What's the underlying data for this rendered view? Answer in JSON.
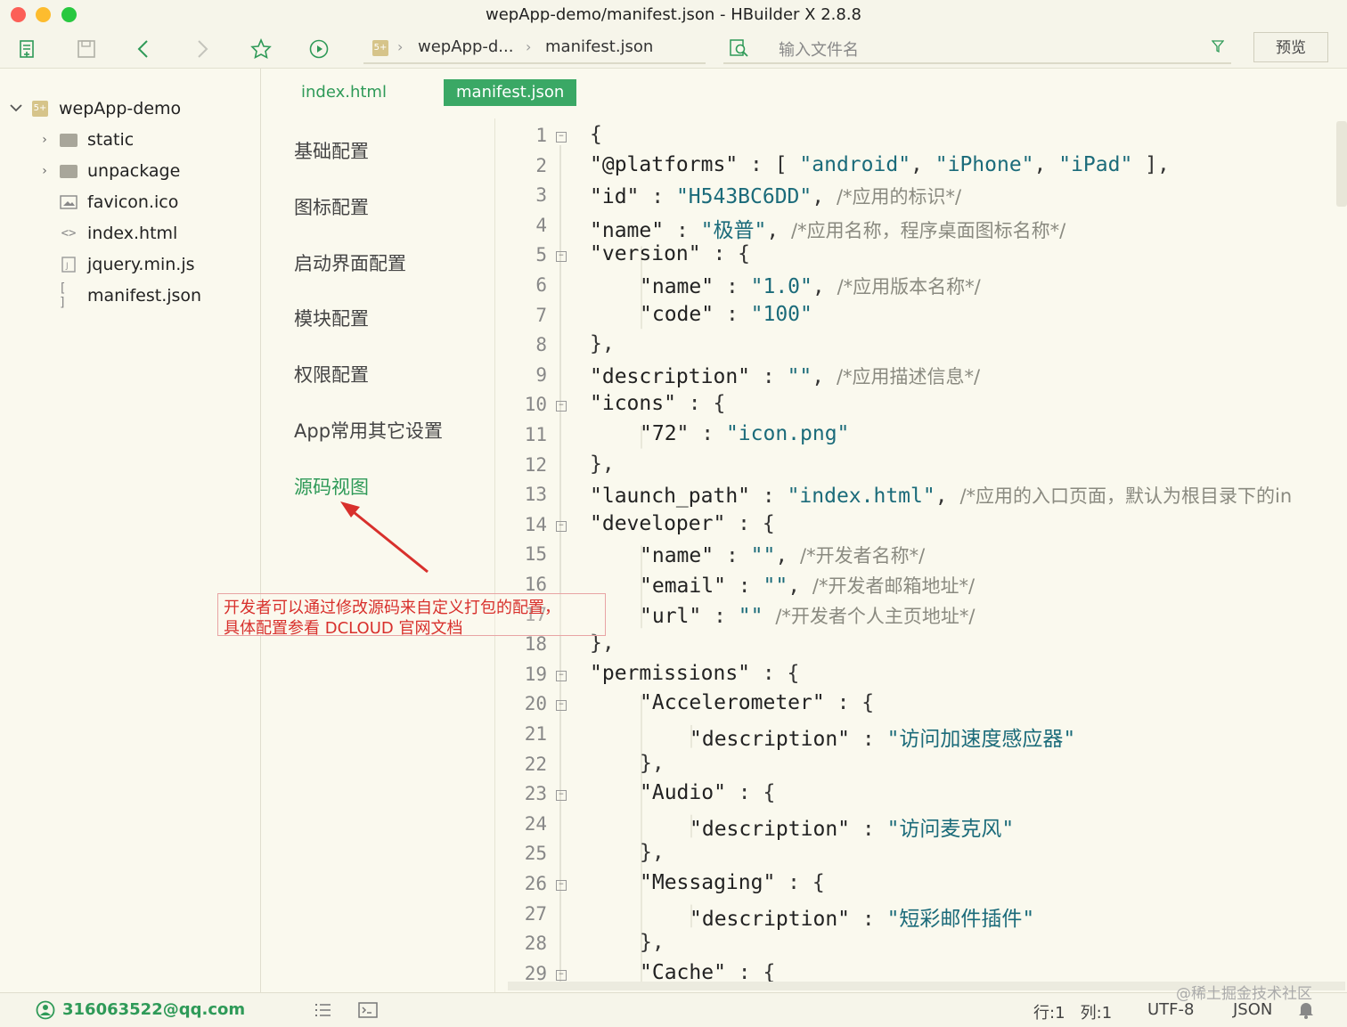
{
  "window": {
    "title": "wepApp-demo/manifest.json - HBuilder X 2.8.8"
  },
  "toolbar": {
    "breadcrumb_project_icon": "5+",
    "breadcrumb_project": "wepApp-d...",
    "breadcrumb_file": "manifest.json",
    "search_placeholder": "输入文件名",
    "preview_label": "预览"
  },
  "sidebar": {
    "project": {
      "name": "wepApp-demo",
      "icon": "5+"
    },
    "items": [
      {
        "label": "static",
        "type": "folder"
      },
      {
        "label": "unpackage",
        "type": "folder"
      },
      {
        "label": "favicon.ico",
        "type": "image"
      },
      {
        "label": "index.html",
        "type": "html"
      },
      {
        "label": "jquery.min.js",
        "type": "js"
      },
      {
        "label": "manifest.json",
        "type": "json"
      }
    ]
  },
  "tabs": [
    {
      "label": "index.html",
      "active": false
    },
    {
      "label": "manifest.json",
      "active": true
    }
  ],
  "settings_menu": [
    {
      "label": "基础配置"
    },
    {
      "label": "图标配置"
    },
    {
      "label": "启动界面配置"
    },
    {
      "label": "模块配置"
    },
    {
      "label": "权限配置"
    },
    {
      "label": "App常用其它设置"
    },
    {
      "label": "源码视图",
      "active": true
    }
  ],
  "annotation": {
    "line1": "开发者可以通过修改源码来自定义打包的配置，",
    "line2": "具体配置参看 DCLOUD 官网文档"
  },
  "editor": {
    "lines": [
      {
        "n": "1",
        "fold": "open",
        "indent": 0,
        "tokens": [
          [
            "p",
            "{"
          ]
        ]
      },
      {
        "n": "2",
        "indent": 0,
        "tokens": [
          [
            "k",
            "\"@platforms\""
          ],
          [
            "p",
            " : [ "
          ],
          [
            "s",
            "\"android\""
          ],
          [
            "p",
            ", "
          ],
          [
            "s",
            "\"iPhone\""
          ],
          [
            "p",
            ", "
          ],
          [
            "s",
            "\"iPad\""
          ],
          [
            "p",
            " ],"
          ]
        ]
      },
      {
        "n": "3",
        "indent": 0,
        "tokens": [
          [
            "k",
            "\"id\""
          ],
          [
            "p",
            " : "
          ],
          [
            "s",
            "\"H543BC6DD\""
          ],
          [
            "p",
            ", "
          ],
          [
            "c",
            "/*应用的标识*/"
          ]
        ]
      },
      {
        "n": "4",
        "indent": 0,
        "tokens": [
          [
            "k",
            "\"name\""
          ],
          [
            "p",
            " : "
          ],
          [
            "s",
            "\"极普\""
          ],
          [
            "p",
            ", "
          ],
          [
            "c",
            "/*应用名称，程序桌面图标名称*/"
          ]
        ]
      },
      {
        "n": "5",
        "fold": "open",
        "indent": 0,
        "tokens": [
          [
            "k",
            "\"version\""
          ],
          [
            "p",
            " : {"
          ]
        ]
      },
      {
        "n": "6",
        "indent": 1,
        "tokens": [
          [
            "k",
            "\"name\""
          ],
          [
            "p",
            " : "
          ],
          [
            "s",
            "\"1.0\""
          ],
          [
            "p",
            ", "
          ],
          [
            "c",
            "/*应用版本名称*/"
          ]
        ]
      },
      {
        "n": "7",
        "indent": 1,
        "tokens": [
          [
            "k",
            "\"code\""
          ],
          [
            "p",
            " : "
          ],
          [
            "s",
            "\"100\""
          ]
        ]
      },
      {
        "n": "8",
        "indent": 0,
        "tokens": [
          [
            "p",
            "},"
          ]
        ]
      },
      {
        "n": "9",
        "indent": 0,
        "tokens": [
          [
            "k",
            "\"description\""
          ],
          [
            "p",
            " : "
          ],
          [
            "s",
            "\"\""
          ],
          [
            "p",
            ", "
          ],
          [
            "c",
            "/*应用描述信息*/"
          ]
        ]
      },
      {
        "n": "10",
        "fold": "open",
        "indent": 0,
        "tokens": [
          [
            "k",
            "\"icons\""
          ],
          [
            "p",
            " : {"
          ]
        ]
      },
      {
        "n": "11",
        "indent": 1,
        "tokens": [
          [
            "k",
            "\"72\""
          ],
          [
            "p",
            " : "
          ],
          [
            "s",
            "\"icon.png\""
          ]
        ]
      },
      {
        "n": "12",
        "indent": 0,
        "tokens": [
          [
            "p",
            "},"
          ]
        ]
      },
      {
        "n": "13",
        "indent": 0,
        "tokens": [
          [
            "k",
            "\"launch_path\""
          ],
          [
            "p",
            " : "
          ],
          [
            "s",
            "\"index.html\""
          ],
          [
            "p",
            ", "
          ],
          [
            "c",
            "/*应用的入口页面，默认为根目录下的in"
          ]
        ]
      },
      {
        "n": "14",
        "fold": "open",
        "indent": 0,
        "tokens": [
          [
            "k",
            "\"developer\""
          ],
          [
            "p",
            " : {"
          ]
        ]
      },
      {
        "n": "15",
        "indent": 1,
        "tokens": [
          [
            "k",
            "\"name\""
          ],
          [
            "p",
            " : "
          ],
          [
            "s",
            "\"\""
          ],
          [
            "p",
            ", "
          ],
          [
            "c",
            "/*开发者名称*/"
          ]
        ]
      },
      {
        "n": "16",
        "indent": 1,
        "tokens": [
          [
            "k",
            "\"email\""
          ],
          [
            "p",
            " : "
          ],
          [
            "s",
            "\"\""
          ],
          [
            "p",
            ", "
          ],
          [
            "c",
            "/*开发者邮箱地址*/"
          ]
        ]
      },
      {
        "n": "17",
        "indent": 1,
        "tokens": [
          [
            "k",
            "\"url\""
          ],
          [
            "p",
            " : "
          ],
          [
            "s",
            "\"\""
          ],
          [
            "p",
            " "
          ],
          [
            "c",
            "/*开发者个人主页地址*/"
          ]
        ]
      },
      {
        "n": "18",
        "indent": 0,
        "tokens": [
          [
            "p",
            "},"
          ]
        ]
      },
      {
        "n": "19",
        "fold": "open",
        "indent": 0,
        "tokens": [
          [
            "k",
            "\"permissions\""
          ],
          [
            "p",
            " : {"
          ]
        ]
      },
      {
        "n": "20",
        "fold": "open",
        "indent": 1,
        "tokens": [
          [
            "k",
            "\"Accelerometer\""
          ],
          [
            "p",
            " : {"
          ]
        ]
      },
      {
        "n": "21",
        "indent": 2,
        "tokens": [
          [
            "k",
            "\"description\""
          ],
          [
            "p",
            " : "
          ],
          [
            "s",
            "\"访问加速度感应器\""
          ]
        ]
      },
      {
        "n": "22",
        "indent": 1,
        "tokens": [
          [
            "p",
            "},"
          ]
        ]
      },
      {
        "n": "23",
        "fold": "open",
        "indent": 1,
        "tokens": [
          [
            "k",
            "\"Audio\""
          ],
          [
            "p",
            " : {"
          ]
        ]
      },
      {
        "n": "24",
        "indent": 2,
        "tokens": [
          [
            "k",
            "\"description\""
          ],
          [
            "p",
            " : "
          ],
          [
            "s",
            "\"访问麦克风\""
          ]
        ]
      },
      {
        "n": "25",
        "indent": 1,
        "tokens": [
          [
            "p",
            "},"
          ]
        ]
      },
      {
        "n": "26",
        "fold": "open",
        "indent": 1,
        "tokens": [
          [
            "k",
            "\"Messaging\""
          ],
          [
            "p",
            " : {"
          ]
        ]
      },
      {
        "n": "27",
        "indent": 2,
        "tokens": [
          [
            "k",
            "\"description\""
          ],
          [
            "p",
            " : "
          ],
          [
            "s",
            "\"短彩邮件插件\""
          ]
        ]
      },
      {
        "n": "28",
        "indent": 1,
        "tokens": [
          [
            "p",
            "},"
          ]
        ]
      },
      {
        "n": "29",
        "fold": "open",
        "indent": 1,
        "tokens": [
          [
            "k",
            "\"Cache\""
          ],
          [
            "p",
            " : {"
          ]
        ]
      }
    ]
  },
  "statusbar": {
    "account": "316063522@qq.com",
    "position": "行:1   列:1",
    "encoding": "UTF-8",
    "language": "JSON",
    "watermark": "@稀土掘金技术社区"
  },
  "colors": {
    "accent": "#2f9a58",
    "active_tab_bg": "#3aa865",
    "annotation": "#d8302c"
  }
}
